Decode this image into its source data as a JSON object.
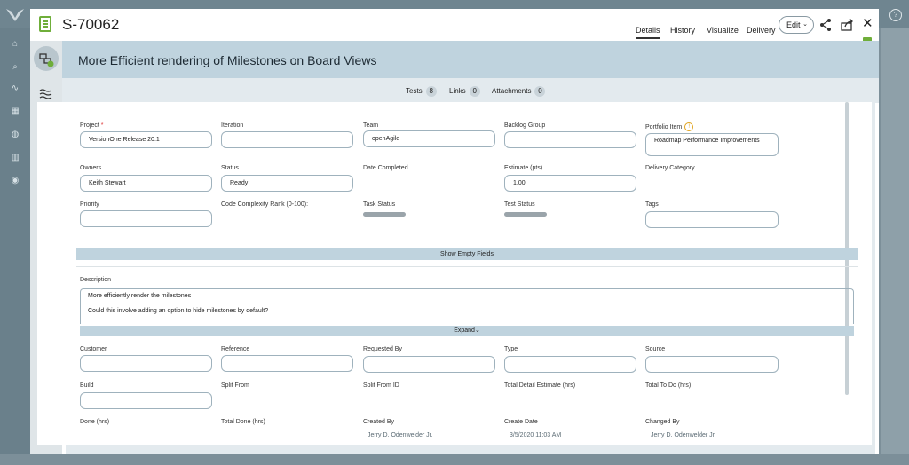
{
  "story": {
    "number": "S-70062",
    "title": "More Efficient rendering of Milestones on Board Views"
  },
  "tabs": [
    "Details",
    "History",
    "Visualize",
    "Delivery"
  ],
  "edit_label": "Edit",
  "counts": {
    "tests_label": "Tests",
    "tests": "8",
    "links_label": "Links",
    "links": "0",
    "attachments_label": "Attachments",
    "attachments": "0"
  },
  "fields": {
    "project": {
      "label": "Project",
      "required_mark": "*",
      "value": "VersionOne Release 20.1"
    },
    "iteration": {
      "label": "Iteration",
      "value": ""
    },
    "team": {
      "label": "Team",
      "value": "openAgile"
    },
    "backlog_group": {
      "label": "Backlog Group",
      "value": ""
    },
    "portfolio_item": {
      "label": "Portfolio Item",
      "value": "Roadmap Performance Improvements"
    },
    "owners": {
      "label": "Owners",
      "value": "Keith Stewart"
    },
    "status": {
      "label": "Status",
      "value": "Ready"
    },
    "date_completed": {
      "label": "Date Completed"
    },
    "estimate": {
      "label": "Estimate (pts)",
      "value": "1.00"
    },
    "delivery_category": {
      "label": "Delivery Category"
    },
    "priority": {
      "label": "Priority",
      "value": ""
    },
    "complexity": {
      "label": "Code Complexity Rank (0-100):"
    },
    "task_status": {
      "label": "Task Status"
    },
    "test_status": {
      "label": "Test Status"
    },
    "tags": {
      "label": "Tags",
      "value": ""
    },
    "customer": {
      "label": "Customer",
      "value": ""
    },
    "reference": {
      "label": "Reference",
      "value": ""
    },
    "requested_by": {
      "label": "Requested By",
      "value": ""
    },
    "type": {
      "label": "Type",
      "value": ""
    },
    "source": {
      "label": "Source",
      "value": ""
    },
    "build": {
      "label": "Build",
      "value": ""
    },
    "split_from": {
      "label": "Split From"
    },
    "split_from_id": {
      "label": "Split From ID"
    },
    "total_detail_estimate": {
      "label": "Total Detail Estimate (hrs)"
    },
    "total_to_do": {
      "label": "Total To Do (hrs)"
    },
    "done": {
      "label": "Done (hrs)"
    },
    "total_done": {
      "label": "Total Done (hrs)"
    },
    "created_by": {
      "label": "Created By",
      "value": "Jerry D. Odenwelder Jr."
    },
    "create_date": {
      "label": "Create Date",
      "value": "3/5/2020 11:03 AM"
    },
    "changed_by": {
      "label": "Changed By",
      "value": "Jerry D. Odenwelder Jr."
    }
  },
  "show_empty_fields": "Show Empty Fields",
  "description": {
    "label": "Description",
    "line1": "More efficiently render the milestones",
    "line2": "Could this involve adding an option to hide milestones by default?"
  },
  "expand_label": "Expand",
  "colors": {
    "accent_green": "#6fae3a",
    "header_blue": "#bfd3de",
    "warning": "#e0a21a"
  }
}
